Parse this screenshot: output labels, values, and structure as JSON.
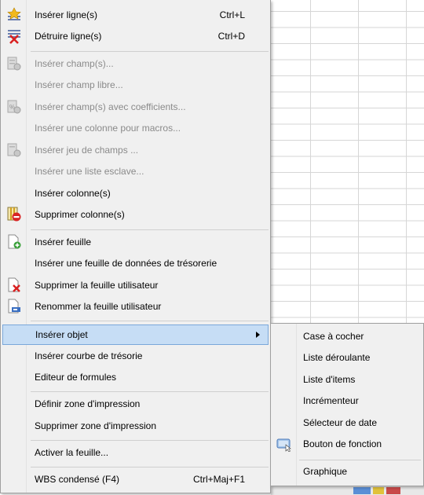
{
  "menu": {
    "items": [
      {
        "label": "Insérer ligne(s)",
        "shortcut": "Ctrl+L",
        "icon": "insert-row-icon",
        "disabled": false
      },
      {
        "label": "Détruire ligne(s)",
        "shortcut": "Ctrl+D",
        "icon": "delete-row-icon",
        "disabled": false
      },
      {
        "label": "Insérer champ(s)...",
        "icon": "insert-field-icon",
        "disabled": true
      },
      {
        "label": "Insérer champ libre...",
        "disabled": true
      },
      {
        "label": "Insérer champ(s) avec coefficients...",
        "icon": "insert-field-coeff-icon",
        "disabled": true
      },
      {
        "label": "Insérer une colonne pour macros...",
        "disabled": true
      },
      {
        "label": "Insérer jeu de champs ...",
        "icon": "insert-fieldset-icon",
        "disabled": true
      },
      {
        "label": "Insérer une liste esclave...",
        "disabled": true
      },
      {
        "label": "Insérer colonne(s)",
        "disabled": false
      },
      {
        "label": "Supprimer colonne(s)",
        "icon": "delete-column-icon",
        "disabled": false
      },
      {
        "label": "Insérer feuille",
        "icon": "insert-sheet-icon",
        "disabled": false
      },
      {
        "label": "Insérer une feuille de données de trésorerie",
        "disabled": false
      },
      {
        "label": "Supprimer la feuille utilisateur",
        "icon": "delete-sheet-icon",
        "disabled": false
      },
      {
        "label": "Renommer la feuille utilisateur",
        "icon": "rename-sheet-icon",
        "disabled": false
      },
      {
        "label": "Insérer objet",
        "highlighted": true,
        "has_submenu": true
      },
      {
        "label": "Insérer courbe de trésorie"
      },
      {
        "label": "Editeur de formules"
      },
      {
        "label": "Définir zone d'impression"
      },
      {
        "label": "Supprimer zone d'impression"
      },
      {
        "label": "Activer la feuille..."
      },
      {
        "label": "WBS condensé (F4)",
        "shortcut": "Ctrl+Maj+F1"
      }
    ]
  },
  "submenu": {
    "items": [
      {
        "label": "Case à cocher"
      },
      {
        "label": "Liste déroulante"
      },
      {
        "label": "Liste d'items"
      },
      {
        "label": "Incrémenteur"
      },
      {
        "label": "Sélecteur de date"
      },
      {
        "label": "Bouton de fonction",
        "icon": "function-button-icon"
      },
      {
        "label": "Graphique"
      }
    ]
  },
  "colors": {
    "highlight_bg": "#c6ddf5",
    "highlight_border": "#7aa7da",
    "disabled_text": "#8a8a8a",
    "menu_bg": "#f0f0f0"
  }
}
